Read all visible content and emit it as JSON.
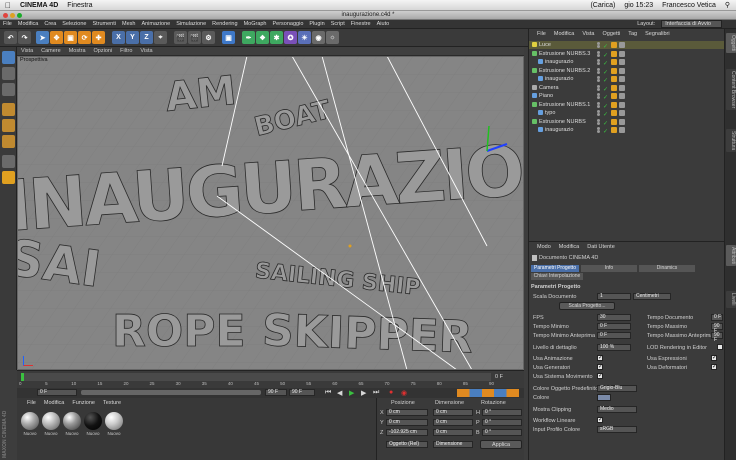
{
  "mac": {
    "app": "CINEMA 4D",
    "menu": "Finestra",
    "status_battery": "(Carica)",
    "clock": "gio 15:23",
    "user": "Francesco Vetica"
  },
  "window": {
    "title": "inaugurazione.c4d *"
  },
  "menubar": {
    "items": [
      "File",
      "Modifica",
      "Crea",
      "Selezione",
      "Strumenti",
      "Mesh",
      "Animazione",
      "Simulazione",
      "Rendering",
      "MoGraph",
      "Personaggio",
      "Plugin",
      "Script",
      "Finestre",
      "Aiuto"
    ],
    "layout_label": "Layout:",
    "layout_value": "Interfaccia di Avvio"
  },
  "toolbar": {
    "axis": [
      "X",
      "Y",
      "Z"
    ]
  },
  "viewport": {
    "menu": [
      "Vista",
      "Camere",
      "Mostra",
      "Opzioni",
      "Filtro",
      "Vista"
    ],
    "label": "Prospettiva",
    "scene_words": [
      "INAUGURAZIO",
      "SAILING SHIP",
      "ROPE",
      "SKIPPER",
      "BOAT",
      "AM",
      "SAI"
    ]
  },
  "timeline": {
    "ticks": [
      "0",
      "5",
      "10",
      "15",
      "20",
      "25",
      "30",
      "35",
      "40",
      "45",
      "50",
      "55",
      "60",
      "65",
      "70",
      "75",
      "80",
      "85",
      "90"
    ],
    "frame": "0 F",
    "start": "0 F",
    "end": "90 F",
    "end2": "90 F",
    "current": "0 F"
  },
  "materials": {
    "menu": [
      "File",
      "Modifica",
      "Funzione",
      "Texture"
    ],
    "items": [
      {
        "name": "Nuovo"
      },
      {
        "name": "Nuovo"
      },
      {
        "name": "Nuovo"
      },
      {
        "name": "Nuovo"
      },
      {
        "name": "Nuovo"
      }
    ],
    "brand": "MAXON CINEMA 4D"
  },
  "coords": {
    "headers": [
      "Posizione",
      "Dimensione",
      "Rotazione"
    ],
    "rows": [
      {
        "axis": "X",
        "pos": "0 cm",
        "dim": "0 cm",
        "rot_axis": "H",
        "rot": "0 °"
      },
      {
        "axis": "Y",
        "pos": "0 cm",
        "dim": "0 cm",
        "rot_axis": "P",
        "rot": "0 °"
      },
      {
        "axis": "Z",
        "pos": "-102.925 cm",
        "dim": "0 cm",
        "rot_axis": "B",
        "rot": "0 °"
      }
    ],
    "mode1": "Oggetto (Rel)",
    "mode2": "Dimensione",
    "apply": "Applica"
  },
  "objects": {
    "menu": [
      "File",
      "Modifica",
      "Vista",
      "Oggetti",
      "Tag",
      "Segnalibri"
    ],
    "items": [
      {
        "name": "Luce",
        "indent": 0,
        "color": "#e0d040",
        "selected": true
      },
      {
        "name": "Estrusione NURBS.3",
        "indent": 0,
        "color": "#66c066"
      },
      {
        "name": "inaugurazio",
        "indent": 1,
        "color": "#66a0e0"
      },
      {
        "name": "Estrusione NURBS.2",
        "indent": 0,
        "color": "#66c066"
      },
      {
        "name": "inaugurazio",
        "indent": 1,
        "color": "#66a0e0"
      },
      {
        "name": "Camera",
        "indent": 0,
        "color": "#aaaaaa"
      },
      {
        "name": "Piano",
        "indent": 0,
        "color": "#66a0e0"
      },
      {
        "name": "Estrusione NURBS.1",
        "indent": 0,
        "color": "#66c066"
      },
      {
        "name": "typo",
        "indent": 1,
        "color": "#66a0e0"
      },
      {
        "name": "Estrusione NURBS",
        "indent": 0,
        "color": "#66c066"
      },
      {
        "name": "inaugurazio",
        "indent": 1,
        "color": "#66a0e0"
      }
    ]
  },
  "attributes": {
    "menu": [
      "Modo",
      "Modifica",
      "Dati Utente"
    ],
    "doc": "Documento CINEMA 4D",
    "tabs": [
      "Parametri Progetto",
      "Info",
      "Dinamics"
    ],
    "subtab": "Chiavi Interpolazione",
    "section": "Parametri Progetto",
    "scale_label": "Scala Documento",
    "scale_value": "1",
    "scale_unit": "Centimetri",
    "scale_btn": "Scala Progetto...",
    "fps_label": "FPS",
    "fps": "30",
    "tdoc_label": "Tempo Documento",
    "tdoc": "0 F",
    "tmin_label": "Tempo Minimo",
    "tmin": "0 F",
    "tmax_label": "Tempo Massimo",
    "tmax": "90 F",
    "tmina_label": "Tempo Minimo Anteprima",
    "tmina": "0 F",
    "tmaxa_label": "Tempo Massimo Anteprima",
    "tmaxa": "90 F",
    "lod_label": "Livello di dettaglio",
    "lod": "100 %",
    "lodr_label": "LOD Rendering in Editor",
    "usaanim": "Usa Animazione",
    "usaespr": "Usa Espressioni",
    "usagen": "Usa Generatori",
    "usadef": "Usa Deformatori",
    "usamov": "Usa Sistema Movimento",
    "colpred_label": "Colore Oggetto Predefinito",
    "colpred": "Grigio-Blu",
    "colore_label": "Colore",
    "clip_label": "Mostra Clipping",
    "clip": "Medio",
    "wf_label": "Workflow Lineare",
    "icp_label": "Input Profilo Colore",
    "icp": "sRGB"
  },
  "rightstrip": {
    "tabs": [
      "Oggetti",
      "Content Browser",
      "Struttura",
      "Attributi",
      "Livelli"
    ]
  }
}
